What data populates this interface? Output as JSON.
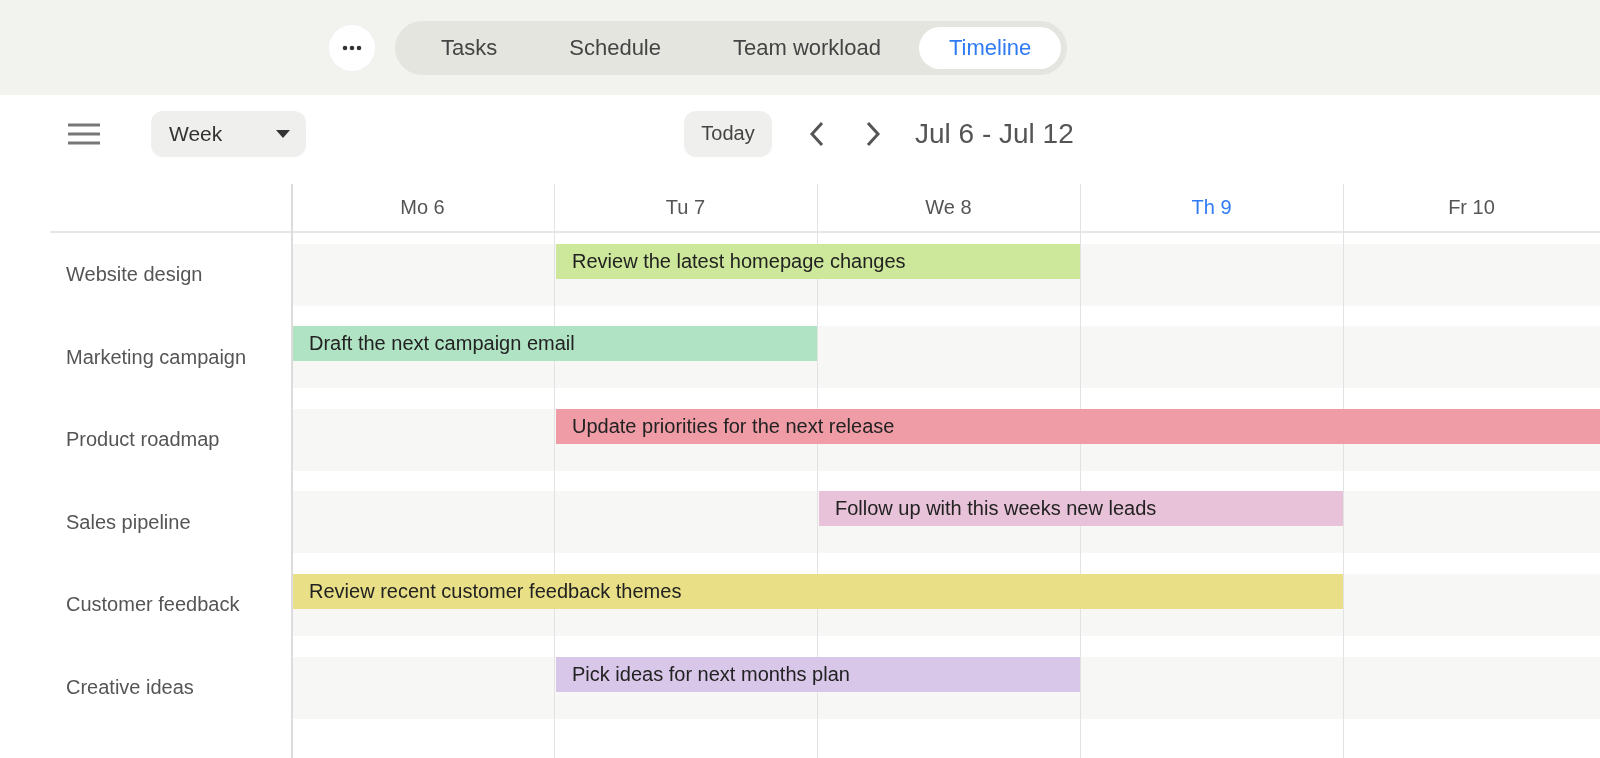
{
  "tabs": [
    {
      "label": "Tasks",
      "selected": false
    },
    {
      "label": "Schedule",
      "selected": false
    },
    {
      "label": "Team workload",
      "selected": false
    },
    {
      "label": "Timeline",
      "selected": true
    }
  ],
  "toolbar": {
    "view_select": "Week",
    "today_button": "Today",
    "date_range": "Jul 6 - Jul 12"
  },
  "days": [
    {
      "label": "Mo 6",
      "today": false
    },
    {
      "label": "Tu 7",
      "today": false
    },
    {
      "label": "We 8",
      "today": false
    },
    {
      "label": "Th 9",
      "today": true
    },
    {
      "label": "Fr 10",
      "today": false
    }
  ],
  "rows": [
    {
      "label": "Website design",
      "task": {
        "title": "Review the latest homepage changes",
        "color": "#cde89a",
        "on_days": [
          false,
          true,
          true,
          false,
          false
        ]
      }
    },
    {
      "label": "Marketing campaign",
      "task": {
        "title": "Draft the next campaign email",
        "color": "#b0e3c3",
        "on_days": [
          true,
          true,
          false,
          false,
          false
        ]
      }
    },
    {
      "label": "Product roadmap",
      "task": {
        "title": "Update priorities for the next release",
        "color": "#f09ca6",
        "on_days": [
          false,
          true,
          true,
          true,
          true
        ]
      }
    },
    {
      "label": "Sales pipeline",
      "task": {
        "title": "Follow up with this weeks new leads",
        "color": "#e8c2d8",
        "on_days": [
          false,
          false,
          true,
          true,
          false
        ]
      }
    },
    {
      "label": "Customer feedback",
      "task": {
        "title": "Review recent customer feedback themes",
        "color": "#e9df86",
        "on_days": [
          true,
          true,
          true,
          true,
          false
        ]
      }
    },
    {
      "label": "Creative ideas",
      "task": {
        "title": "Pick ideas for next months plan",
        "color": "#d9c7ea",
        "on_days": [
          false,
          true,
          true,
          false,
          false
        ]
      }
    }
  ]
}
